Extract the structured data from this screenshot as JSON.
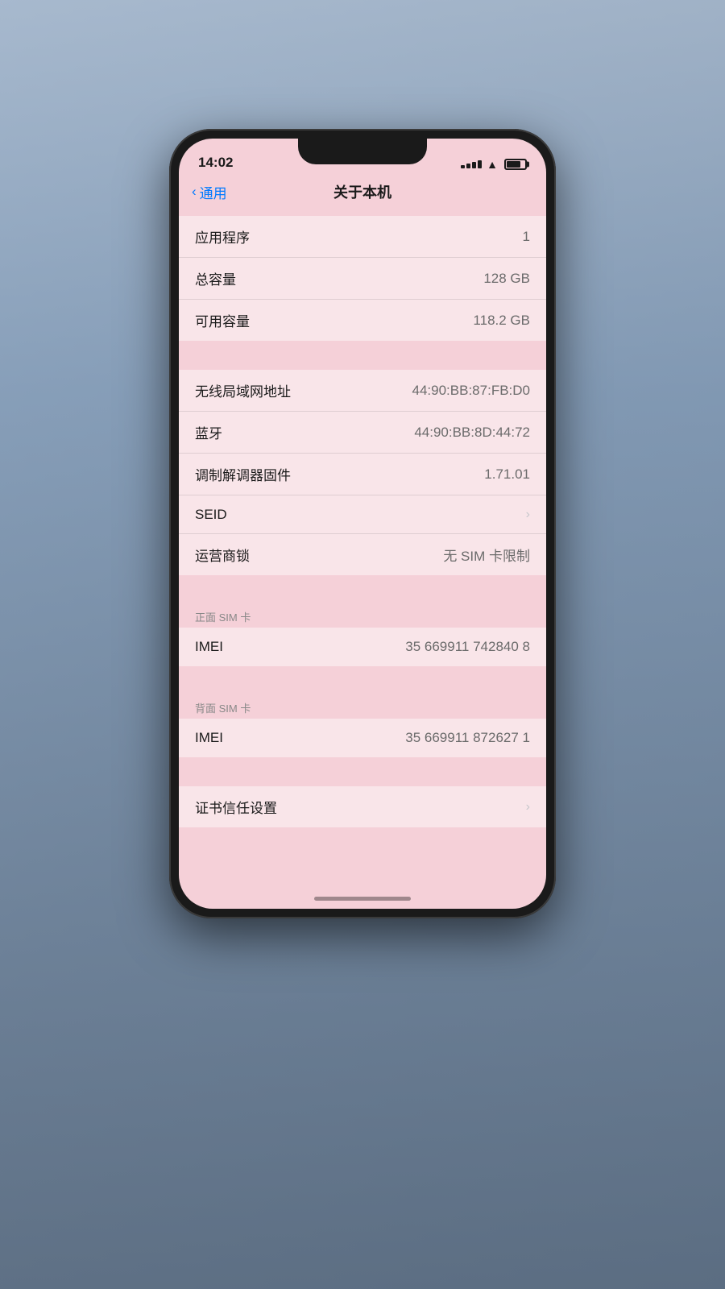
{
  "scene": {
    "background_color": "#5a7090"
  },
  "statusBar": {
    "time": "14:02",
    "battery_level": 70
  },
  "navBar": {
    "back_label": "通用",
    "title": "关于本机"
  },
  "sections": [
    {
      "id": "general-info",
      "items": [
        {
          "label": "应用程序",
          "value": "1",
          "chevron": false
        },
        {
          "label": "总容量",
          "value": "128 GB",
          "chevron": false
        },
        {
          "label": "可用容量",
          "value": "118.2 GB",
          "chevron": false
        }
      ]
    },
    {
      "id": "network-info",
      "items": [
        {
          "label": "无线局域网地址",
          "value": "44:90:BB:87:FB:D0",
          "chevron": false
        },
        {
          "label": "蓝牙",
          "value": "44:90:BB:8D:44:72",
          "chevron": false
        },
        {
          "label": "调制解调器固件",
          "value": "1.71.01",
          "chevron": false
        },
        {
          "label": "SEID",
          "value": "",
          "chevron": true
        },
        {
          "label": "运营商锁",
          "value": "无 SIM 卡限制",
          "chevron": false
        }
      ]
    },
    {
      "id": "front-sim",
      "header": "正面 SIM 卡",
      "items": [
        {
          "label": "IMEI",
          "value": "35 669911 742840 8",
          "chevron": false
        }
      ]
    },
    {
      "id": "back-sim",
      "header": "背面 SIM 卡",
      "items": [
        {
          "label": "IMEI",
          "value": "35 669911 872627 1",
          "chevron": false
        }
      ]
    },
    {
      "id": "certificate",
      "items": [
        {
          "label": "证书信任设置",
          "value": "",
          "chevron": true
        }
      ]
    }
  ]
}
